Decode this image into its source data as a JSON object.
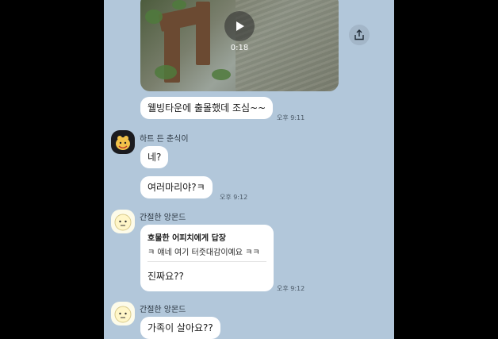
{
  "video": {
    "duration": "0:18",
    "play_icon": "play-icon",
    "share_icon": "share-icon"
  },
  "messages": [
    {
      "text": "웰빙타운에 출몰했데 조심~~",
      "time": "오후 9:11"
    },
    {
      "sender": "하트 든 춘식이"
    },
    {
      "text": "네?"
    },
    {
      "text": "여러마리야?ㅋ",
      "time": "오후 9:12"
    },
    {
      "sender": "간절한 앙몬드"
    },
    {
      "reply_title": "호물한 어피치에게 답장",
      "reply_quote": "ㅋ 얘네 여기 터줏대감이예요 ㅋㅋ",
      "text": "진짜요??",
      "time": "오후 9:12"
    },
    {
      "sender": "간절한 앙몬드"
    },
    {
      "text": "가족이 살아요??"
    }
  ],
  "colors": {
    "chat_bg": "#b2c7da",
    "bubble": "#ffffff",
    "frame": "#000000"
  }
}
